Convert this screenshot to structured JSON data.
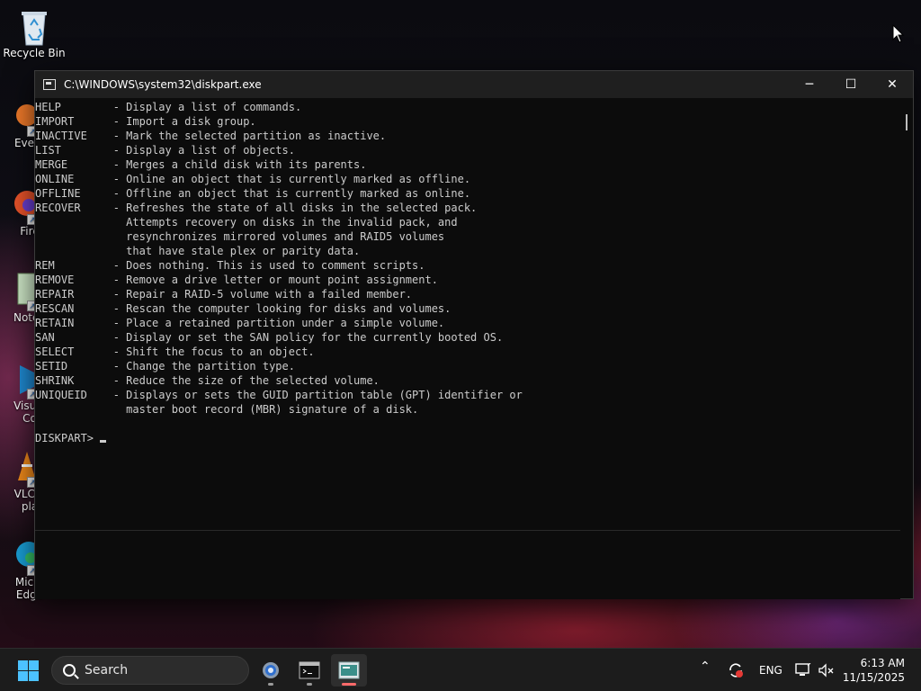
{
  "desktop": {
    "icons": [
      {
        "label": "Recycle Bin"
      },
      {
        "label": "Every"
      },
      {
        "label": "Fire"
      },
      {
        "label": "Notep"
      },
      {
        "label": "Visual",
        "label2": "Co"
      },
      {
        "label": "VLC n",
        "label2": "pla"
      },
      {
        "label": "Micro",
        "label2": "Edge"
      }
    ]
  },
  "window": {
    "title": "C:\\WINDOWS\\system32\\diskpart.exe",
    "controls": {
      "minimize": "─",
      "maximize": "☐",
      "close": "✕"
    }
  },
  "console": {
    "lines": [
      "HELP        - Display a list of commands.",
      "IMPORT      - Import a disk group.",
      "INACTIVE    - Mark the selected partition as inactive.",
      "LIST        - Display a list of objects.",
      "MERGE       - Merges a child disk with its parents.",
      "ONLINE      - Online an object that is currently marked as offline.",
      "OFFLINE     - Offline an object that is currently marked as online.",
      "RECOVER     - Refreshes the state of all disks in the selected pack.",
      "              Attempts recovery on disks in the invalid pack, and",
      "              resynchronizes mirrored volumes and RAID5 volumes",
      "              that have stale plex or parity data.",
      "REM         - Does nothing. This is used to comment scripts.",
      "REMOVE      - Remove a drive letter or mount point assignment.",
      "REPAIR      - Repair a RAID-5 volume with a failed member.",
      "RESCAN      - Rescan the computer looking for disks and volumes.",
      "RETAIN      - Place a retained partition under a simple volume.",
      "SAN         - Display or set the SAN policy for the currently booted OS.",
      "SELECT      - Shift the focus to an object.",
      "SETID       - Change the partition type.",
      "SHRINK      - Reduce the size of the selected volume.",
      "UNIQUEID    - Displays or sets the GUID partition table (GPT) identifier or",
      "              master boot record (MBR) signature of a disk.",
      ""
    ],
    "prompt": "DISKPART> "
  },
  "taskbar": {
    "search_placeholder": "Search",
    "tray": {
      "language": "ENG",
      "chevron": "^"
    },
    "clock": {
      "time": "6:13 AM",
      "date": "11/15/2025"
    }
  },
  "colors": {
    "console_bg": "#0c0c0c",
    "console_fg": "#cccccc",
    "titlebar_bg": "#1f1f1f",
    "taskbar_bg": "#1c1c1c",
    "start_accent": "#4cc2ff"
  }
}
